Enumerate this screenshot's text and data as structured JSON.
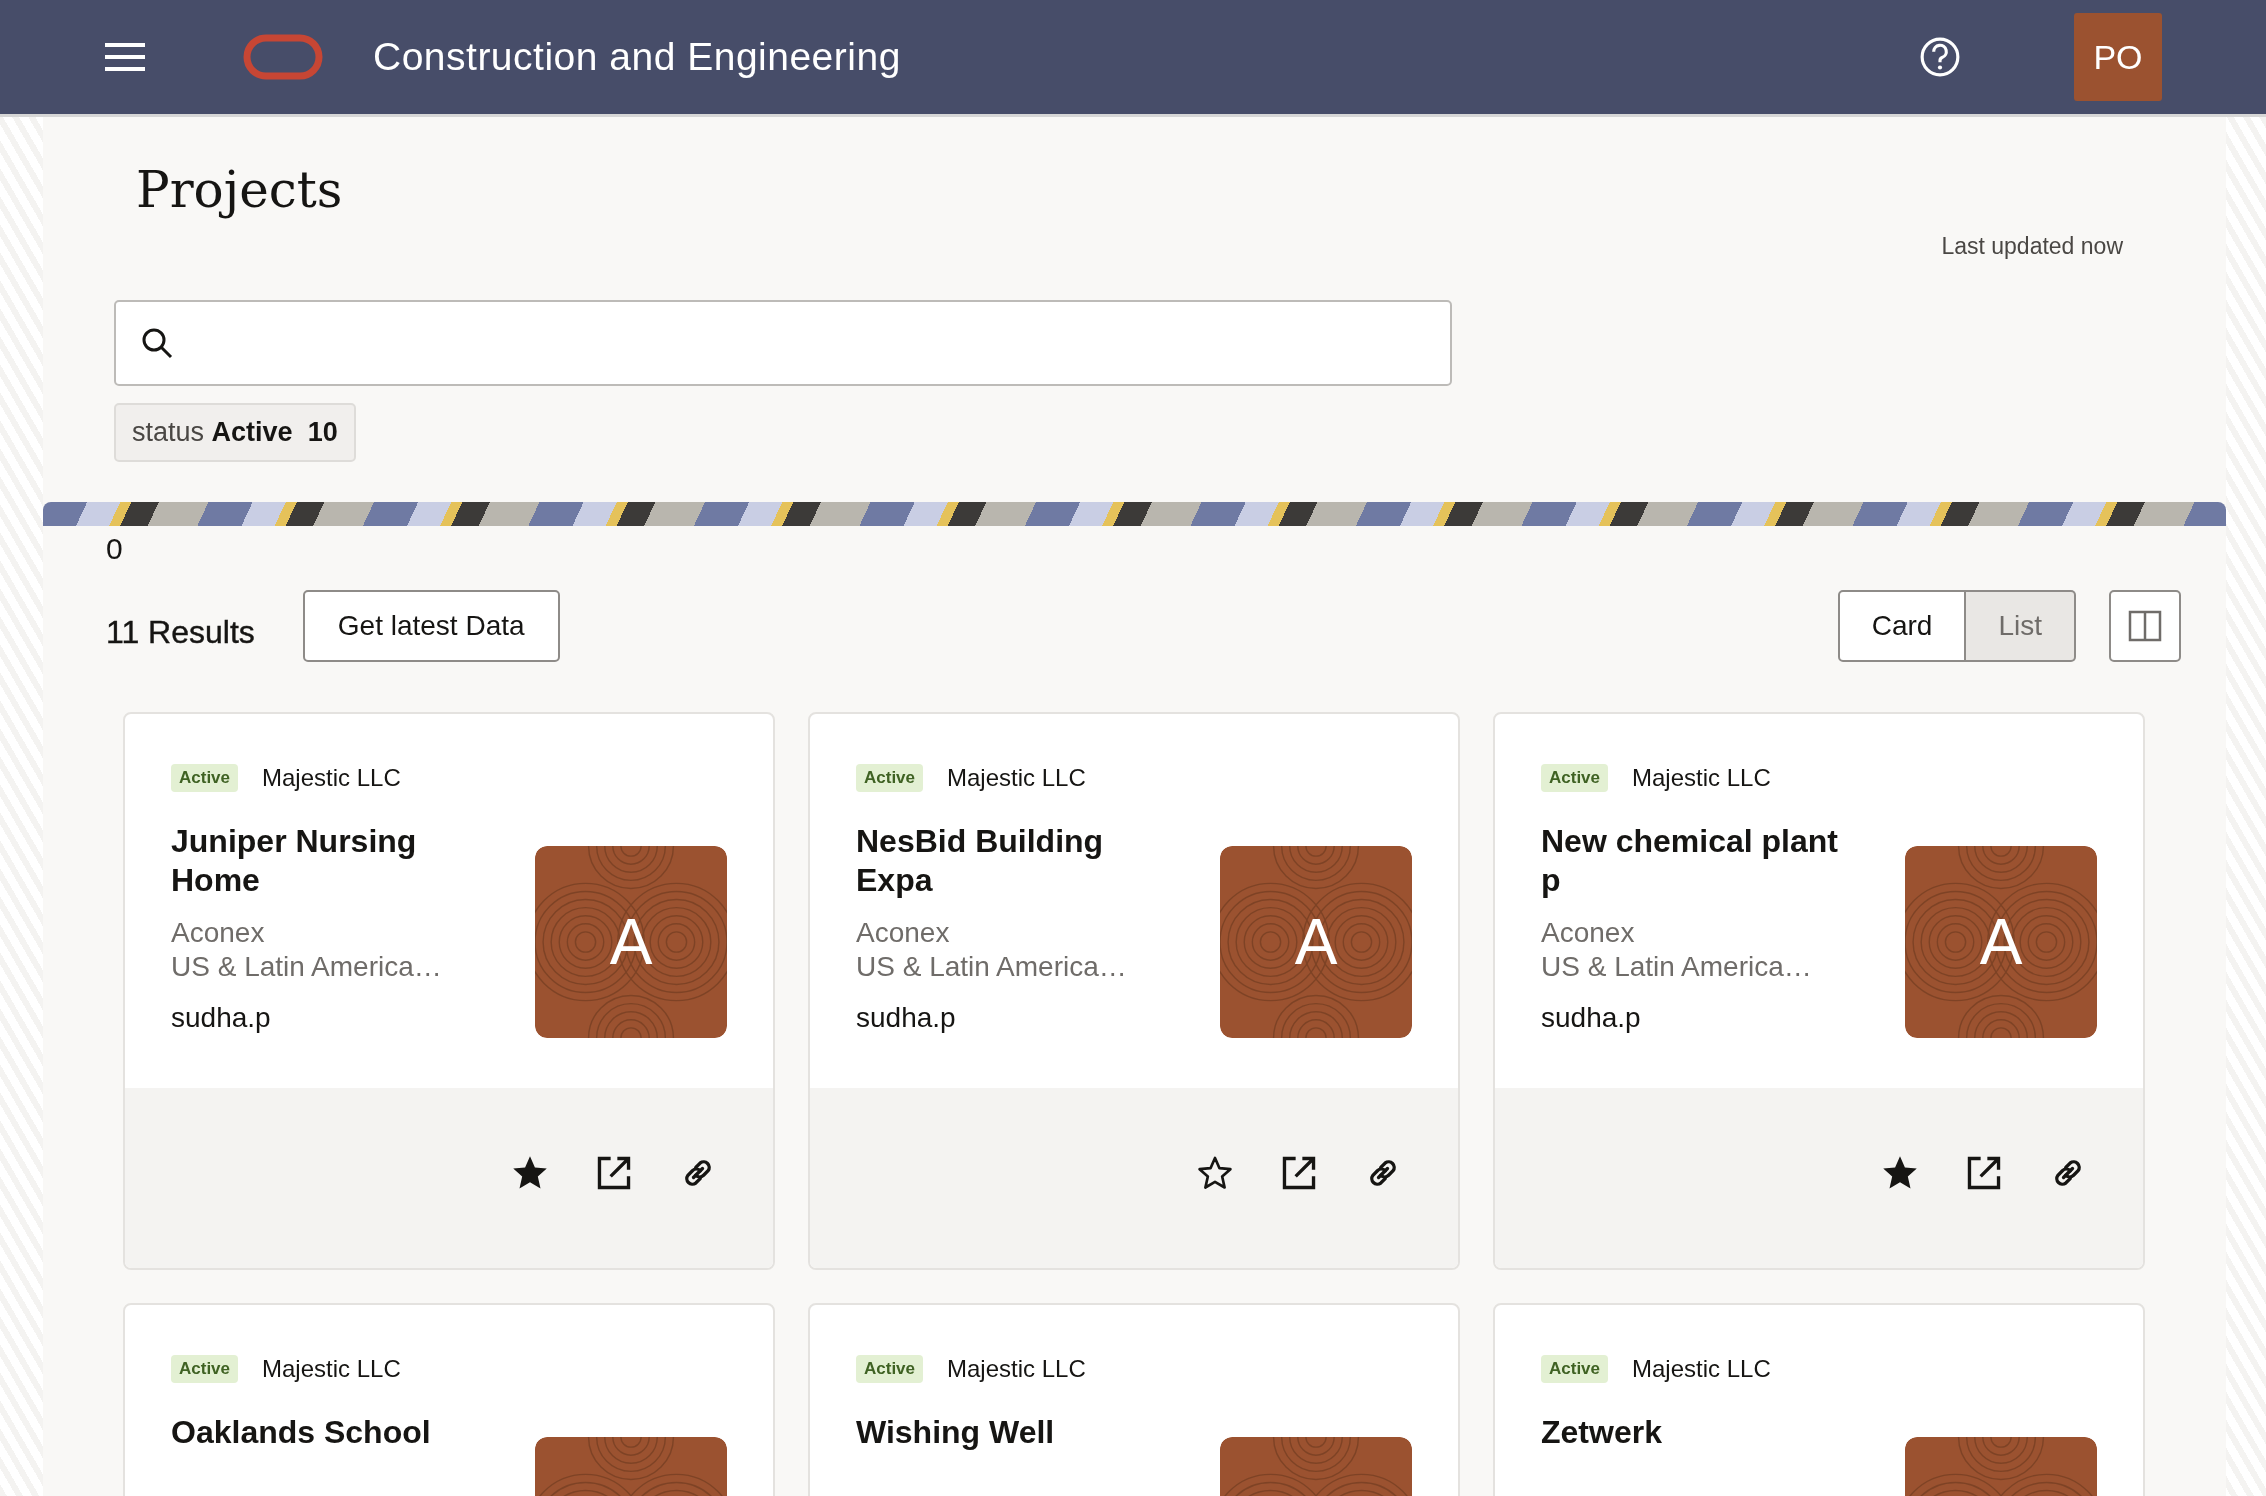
{
  "header": {
    "title": "Construction and Engineering",
    "avatar_initials": "PO"
  },
  "page": {
    "title": "Projects",
    "last_updated": "Last updated now"
  },
  "filter_chip": {
    "label": "status",
    "value": "Active",
    "count": "10"
  },
  "counter": "0",
  "results": {
    "count": "11 Results",
    "refresh_button": "Get latest Data"
  },
  "view_toggle": [
    {
      "label": "Card",
      "selected": true
    },
    {
      "label": "List",
      "selected": false
    }
  ],
  "cards": [
    {
      "status": "Active",
      "company": "Majestic LLC",
      "title": "Juniper Nursing Home",
      "product": "Aconex",
      "region": "US & Latin America…",
      "owner": "sudha.p",
      "initial": "A",
      "favorite": true
    },
    {
      "status": "Active",
      "company": "Majestic LLC",
      "title": "NesBid Building Expa",
      "product": "Aconex",
      "region": "US & Latin America…",
      "owner": "sudha.p",
      "initial": "A",
      "favorite": false
    },
    {
      "status": "Active",
      "company": "Majestic LLC",
      "title": "New chemical plant p",
      "product": "Aconex",
      "region": "US & Latin America…",
      "owner": "sudha.p",
      "initial": "A",
      "favorite": true
    },
    {
      "status": "Active",
      "company": "Majestic LLC",
      "title": "Oaklands School"
    },
    {
      "status": "Active",
      "company": "Majestic LLC",
      "title": "Wishing Well"
    },
    {
      "status": "Active",
      "company": "Majestic LLC",
      "title": "Zetwerk"
    }
  ]
}
